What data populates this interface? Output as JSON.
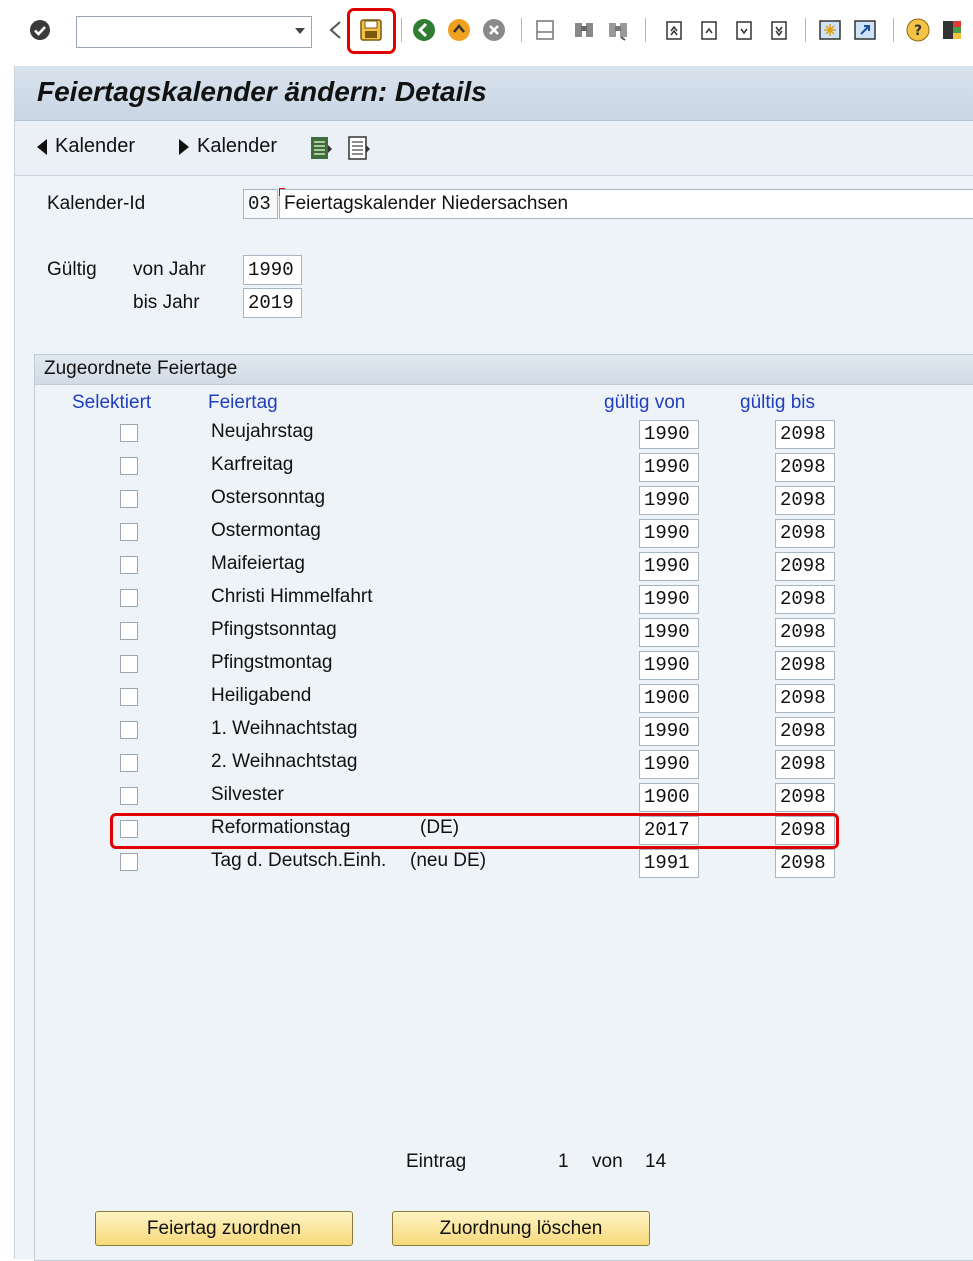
{
  "toolbar": {
    "command_value": "",
    "icons": [
      "check-icon",
      "back-nav-icon",
      "save-icon",
      "back-icon",
      "exit-icon",
      "cancel-icon",
      "print-icon",
      "find-icon",
      "find-next-icon",
      "first-page-icon",
      "prev-page-icon",
      "next-page-icon",
      "last-page-icon",
      "new-session-icon",
      "shortcut-icon",
      "help-icon",
      "layout-icon"
    ],
    "highlight_color": "#e00000"
  },
  "header": {
    "title": "Feiertagskalender ändern: Details"
  },
  "appbar": {
    "prev_label": "Kalender",
    "next_label": "Kalender"
  },
  "form": {
    "calendar_id_label": "Kalender-Id",
    "calendar_id": "03",
    "calendar_name": "Feiertagskalender Niedersachsen",
    "valid_label": "Gültig",
    "from_year_label": "von Jahr",
    "from_year": "1990",
    "to_year_label": "bis Jahr",
    "to_year": "2019"
  },
  "group": {
    "title": "Zugeordnete Feiertage",
    "columns": {
      "selected": "Selektiert",
      "holiday": "Feiertag",
      "valid_from": "gültig von",
      "valid_to": "gültig bis"
    },
    "rows": [
      {
        "name": "Neujahrstag",
        "suffix": "",
        "from": "1990",
        "to": "2098"
      },
      {
        "name": "Karfreitag",
        "suffix": "",
        "from": "1990",
        "to": "2098"
      },
      {
        "name": "Ostersonntag",
        "suffix": "",
        "from": "1990",
        "to": "2098"
      },
      {
        "name": "Ostermontag",
        "suffix": "",
        "from": "1990",
        "to": "2098"
      },
      {
        "name": "Maifeiertag",
        "suffix": "",
        "from": "1990",
        "to": "2098"
      },
      {
        "name": "Christi Himmelfahrt",
        "suffix": "",
        "from": "1990",
        "to": "2098"
      },
      {
        "name": "Pfingstsonntag",
        "suffix": "",
        "from": "1990",
        "to": "2098"
      },
      {
        "name": "Pfingstmontag",
        "suffix": "",
        "from": "1990",
        "to": "2098"
      },
      {
        "name": "Heiligabend",
        "suffix": "",
        "from": "1900",
        "to": "2098"
      },
      {
        "name": "1. Weihnachtstag",
        "suffix": "",
        "from": "1990",
        "to": "2098"
      },
      {
        "name": "2. Weihnachtstag",
        "suffix": "",
        "from": "1990",
        "to": "2098"
      },
      {
        "name": "Silvester",
        "suffix": "",
        "from": "1900",
        "to": "2098"
      },
      {
        "name": "Reformationstag",
        "suffix": "(DE)",
        "from": "2017",
        "to": "2098",
        "highlighted": true
      },
      {
        "name": "Tag d. Deutsch.Einh.",
        "suffix": "(neu DE)",
        "from": "1991",
        "to": "2098"
      }
    ],
    "pager": {
      "entry_label": "Eintrag",
      "current": "1",
      "of_label": "von",
      "total": "14"
    },
    "assign_button": "Feiertag zuordnen",
    "delete_button": "Zuordnung löschen"
  }
}
